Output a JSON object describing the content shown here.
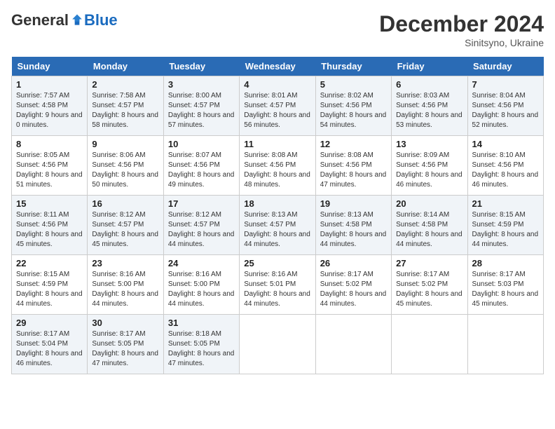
{
  "header": {
    "logo_general": "General",
    "logo_blue": "Blue",
    "month_title": "December 2024",
    "location": "Sinitsyno, Ukraine"
  },
  "weekdays": [
    "Sunday",
    "Monday",
    "Tuesday",
    "Wednesday",
    "Thursday",
    "Friday",
    "Saturday"
  ],
  "weeks": [
    [
      {
        "day": "1",
        "sunrise": "7:57 AM",
        "sunset": "4:58 PM",
        "daylight": "9 hours and 0 minutes."
      },
      {
        "day": "2",
        "sunrise": "7:58 AM",
        "sunset": "4:57 PM",
        "daylight": "8 hours and 58 minutes."
      },
      {
        "day": "3",
        "sunrise": "8:00 AM",
        "sunset": "4:57 PM",
        "daylight": "8 hours and 57 minutes."
      },
      {
        "day": "4",
        "sunrise": "8:01 AM",
        "sunset": "4:57 PM",
        "daylight": "8 hours and 56 minutes."
      },
      {
        "day": "5",
        "sunrise": "8:02 AM",
        "sunset": "4:56 PM",
        "daylight": "8 hours and 54 minutes."
      },
      {
        "day": "6",
        "sunrise": "8:03 AM",
        "sunset": "4:56 PM",
        "daylight": "8 hours and 53 minutes."
      },
      {
        "day": "7",
        "sunrise": "8:04 AM",
        "sunset": "4:56 PM",
        "daylight": "8 hours and 52 minutes."
      }
    ],
    [
      {
        "day": "8",
        "sunrise": "8:05 AM",
        "sunset": "4:56 PM",
        "daylight": "8 hours and 51 minutes."
      },
      {
        "day": "9",
        "sunrise": "8:06 AM",
        "sunset": "4:56 PM",
        "daylight": "8 hours and 50 minutes."
      },
      {
        "day": "10",
        "sunrise": "8:07 AM",
        "sunset": "4:56 PM",
        "daylight": "8 hours and 49 minutes."
      },
      {
        "day": "11",
        "sunrise": "8:08 AM",
        "sunset": "4:56 PM",
        "daylight": "8 hours and 48 minutes."
      },
      {
        "day": "12",
        "sunrise": "8:08 AM",
        "sunset": "4:56 PM",
        "daylight": "8 hours and 47 minutes."
      },
      {
        "day": "13",
        "sunrise": "8:09 AM",
        "sunset": "4:56 PM",
        "daylight": "8 hours and 46 minutes."
      },
      {
        "day": "14",
        "sunrise": "8:10 AM",
        "sunset": "4:56 PM",
        "daylight": "8 hours and 46 minutes."
      }
    ],
    [
      {
        "day": "15",
        "sunrise": "8:11 AM",
        "sunset": "4:56 PM",
        "daylight": "8 hours and 45 minutes."
      },
      {
        "day": "16",
        "sunrise": "8:12 AM",
        "sunset": "4:57 PM",
        "daylight": "8 hours and 45 minutes."
      },
      {
        "day": "17",
        "sunrise": "8:12 AM",
        "sunset": "4:57 PM",
        "daylight": "8 hours and 44 minutes."
      },
      {
        "day": "18",
        "sunrise": "8:13 AM",
        "sunset": "4:57 PM",
        "daylight": "8 hours and 44 minutes."
      },
      {
        "day": "19",
        "sunrise": "8:13 AM",
        "sunset": "4:58 PM",
        "daylight": "8 hours and 44 minutes."
      },
      {
        "day": "20",
        "sunrise": "8:14 AM",
        "sunset": "4:58 PM",
        "daylight": "8 hours and 44 minutes."
      },
      {
        "day": "21",
        "sunrise": "8:15 AM",
        "sunset": "4:59 PM",
        "daylight": "8 hours and 44 minutes."
      }
    ],
    [
      {
        "day": "22",
        "sunrise": "8:15 AM",
        "sunset": "4:59 PM",
        "daylight": "8 hours and 44 minutes."
      },
      {
        "day": "23",
        "sunrise": "8:16 AM",
        "sunset": "5:00 PM",
        "daylight": "8 hours and 44 minutes."
      },
      {
        "day": "24",
        "sunrise": "8:16 AM",
        "sunset": "5:00 PM",
        "daylight": "8 hours and 44 minutes."
      },
      {
        "day": "25",
        "sunrise": "8:16 AM",
        "sunset": "5:01 PM",
        "daylight": "8 hours and 44 minutes."
      },
      {
        "day": "26",
        "sunrise": "8:17 AM",
        "sunset": "5:02 PM",
        "daylight": "8 hours and 44 minutes."
      },
      {
        "day": "27",
        "sunrise": "8:17 AM",
        "sunset": "5:02 PM",
        "daylight": "8 hours and 45 minutes."
      },
      {
        "day": "28",
        "sunrise": "8:17 AM",
        "sunset": "5:03 PM",
        "daylight": "8 hours and 45 minutes."
      }
    ],
    [
      {
        "day": "29",
        "sunrise": "8:17 AM",
        "sunset": "5:04 PM",
        "daylight": "8 hours and 46 minutes."
      },
      {
        "day": "30",
        "sunrise": "8:17 AM",
        "sunset": "5:05 PM",
        "daylight": "8 hours and 47 minutes."
      },
      {
        "day": "31",
        "sunrise": "8:18 AM",
        "sunset": "5:05 PM",
        "daylight": "8 hours and 47 minutes."
      },
      null,
      null,
      null,
      null
    ]
  ],
  "labels": {
    "sunrise": "Sunrise:",
    "sunset": "Sunset:",
    "daylight": "Daylight:"
  }
}
